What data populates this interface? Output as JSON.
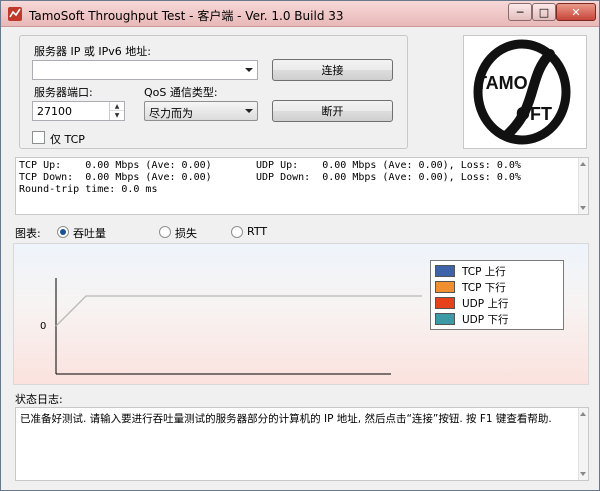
{
  "window": {
    "title": "TamoSoft Throughput Test - 客户端 - Ver. 1.0 Build 33",
    "min_label": "─",
    "max_label": "□",
    "close_label": "✕"
  },
  "connection": {
    "server_label": "服务器 IP 或 IPv6 地址:",
    "server_value": "",
    "port_label": "服务器端口:",
    "port_value": "27100",
    "qos_label": "QoS 通信类型:",
    "qos_value": "尽力而为",
    "tcp_only_label": "仅 TCP",
    "tcp_only_checked": false,
    "connect_button": "连接",
    "disconnect_button": "断开"
  },
  "logo": {
    "text_top": "TAMO",
    "text_bottom": "OFT",
    "text_s": "S"
  },
  "stats": {
    "tcp_up": "TCP Up:    0.00 Mbps (Ave: 0.00)",
    "tcp_down": "TCP Down:  0.00 Mbps (Ave: 0.00)",
    "udp_up": "UDP Up:    0.00 Mbps (Ave: 0.00), Loss: 0.0%",
    "udp_down": "UDP Down:  0.00 Mbps (Ave: 0.00), Loss: 0.0%",
    "rtt": "Round-trip time: 0.0 ms"
  },
  "chart_selector": {
    "label": "图表:",
    "options": [
      "吞吐量",
      "损失",
      "RTT"
    ],
    "selected": "吞吐量"
  },
  "chart_data": {
    "type": "line",
    "yticks": [
      "0"
    ],
    "series": [
      {
        "name": "TCP 上行",
        "color": "#3f63a8"
      },
      {
        "name": "TCP 下行",
        "color": "#ef8f30"
      },
      {
        "name": "UDP 上行",
        "color": "#e5421b"
      },
      {
        "name": "UDP 下行",
        "color": "#3b9aa6"
      }
    ]
  },
  "log": {
    "label": "状态日志:",
    "message": "已准备好测试. 请输入要进行吞吐量测试的服务器部分的计算机的 IP 地址, 然后点击“连接”按钮. 按 F1 键查看帮助."
  }
}
